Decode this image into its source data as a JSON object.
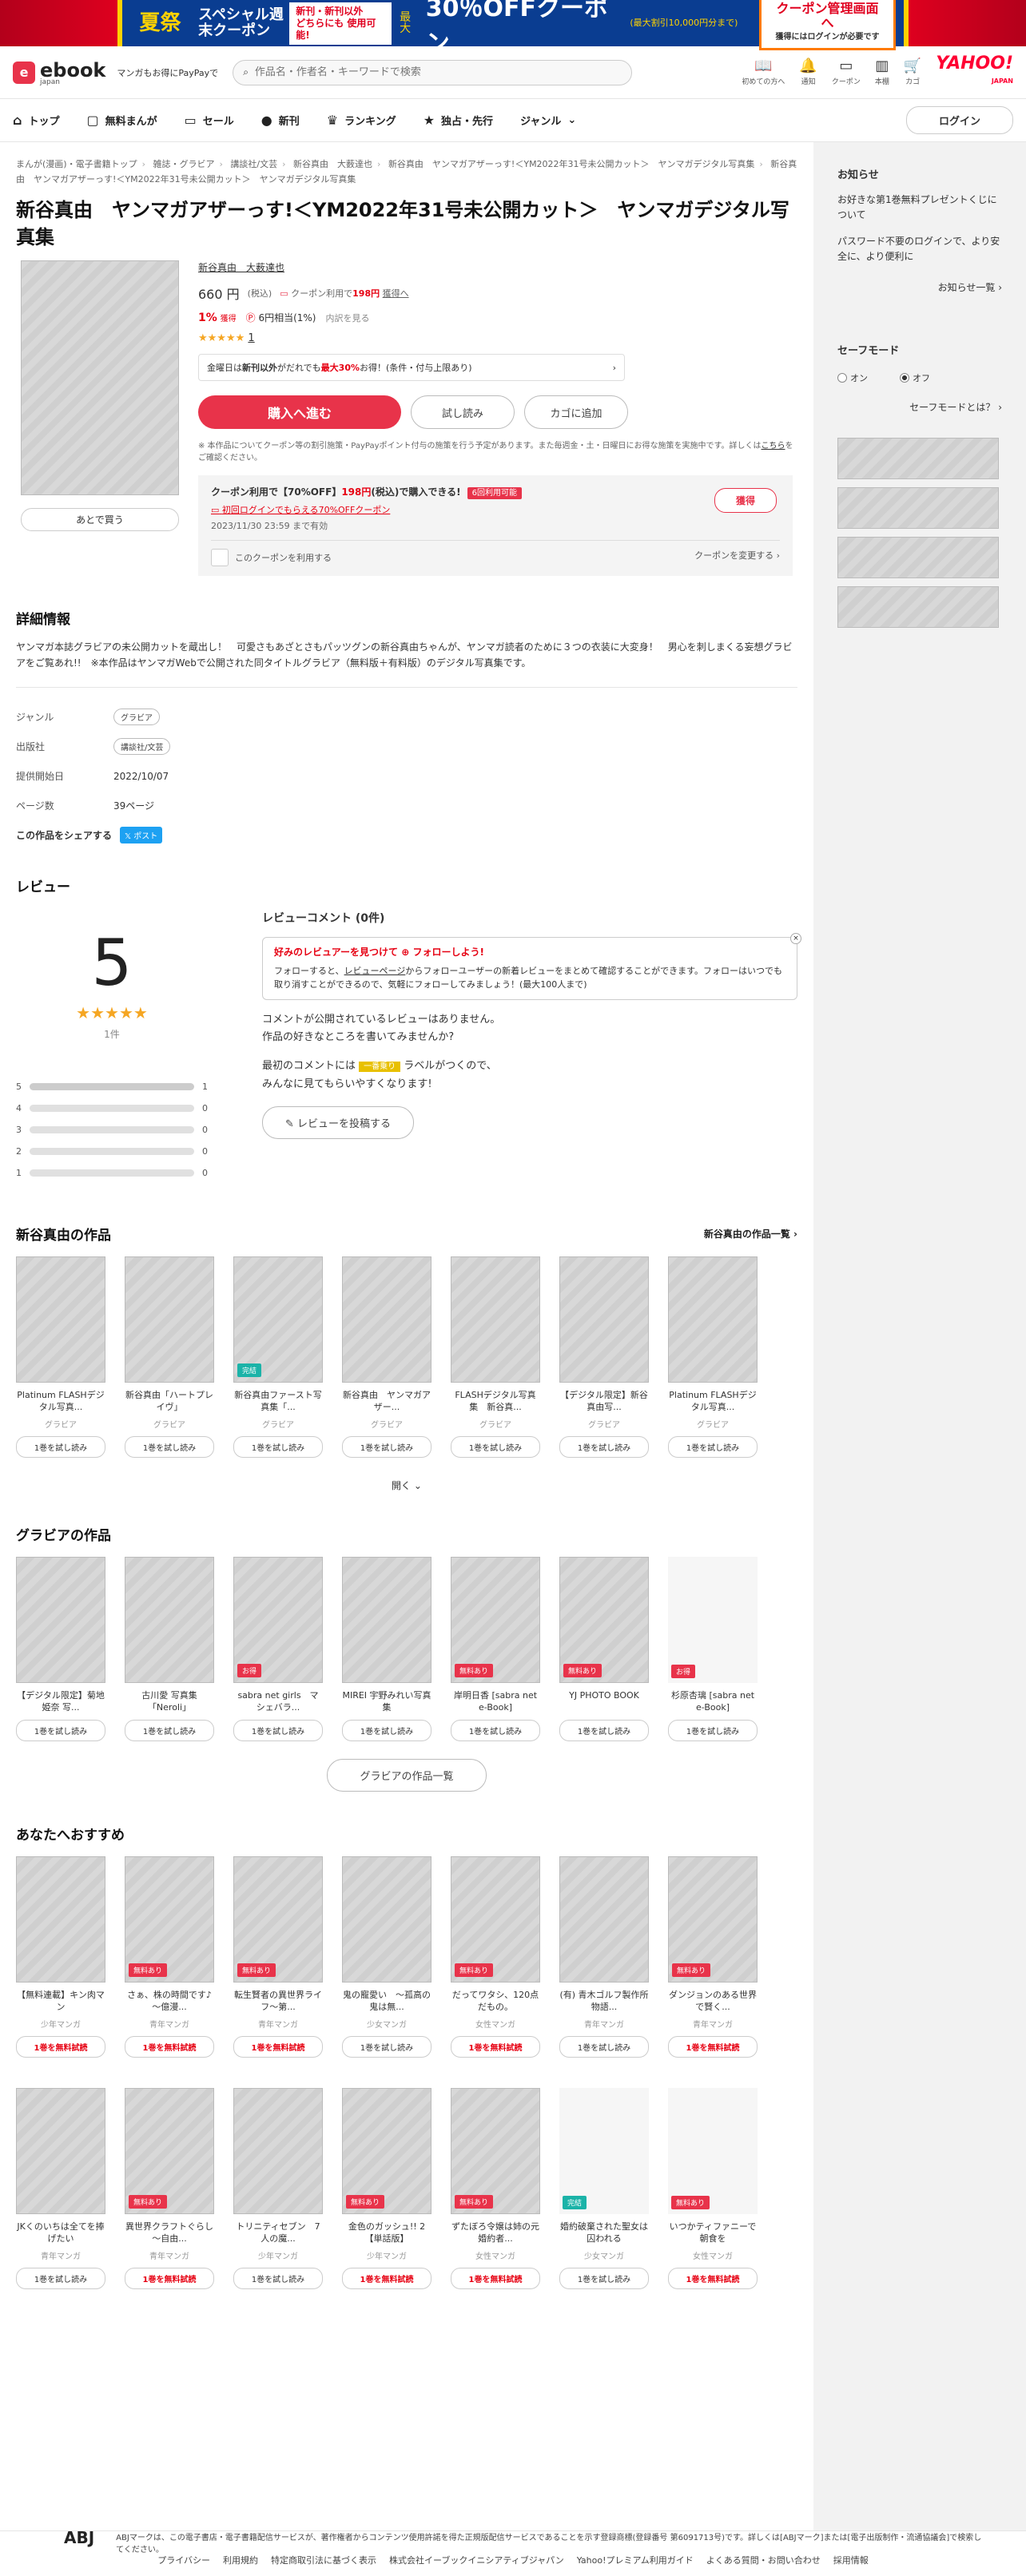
{
  "banner": {
    "a": "夏祭",
    "b": "スペシャル週末クーポン",
    "c1": "新刊・新刊以外",
    "c2": "どちらにも 使用可能!",
    "d_pre": "最大",
    "d": "30％OFFクーポン",
    "e": "(最大割引10,000円分まで)",
    "f": "クーポン管理画面へ",
    "f_sub": "獲得にはログインが必要です"
  },
  "header": {
    "logo": "ebook",
    "logo_sub": "japan",
    "tagline": "マンガもお得にPayPayで",
    "search_placeholder": "作品名・作者名・キーワードで検索",
    "icons": [
      {
        "label": "初めての方へ",
        "icon": "book-icon"
      },
      {
        "label": "通知",
        "icon": "bell-icon"
      },
      {
        "label": "クーポン",
        "icon": "ticket-icon"
      },
      {
        "label": "本棚",
        "icon": "bookshelf-icon"
      },
      {
        "label": "カゴ",
        "icon": "cart-icon"
      }
    ],
    "yahoo": "YAHOO!",
    "yahoo_sub": "JAPAN"
  },
  "nav": {
    "items": [
      "トップ",
      "無料まんが",
      "セール",
      "新刊",
      "ランキング",
      "独占・先行",
      "ジャンル"
    ],
    "login": "ログイン"
  },
  "breadcrumb": [
    "まんが(漫画)・電子書籍トップ",
    "雑誌・グラビア",
    "講談社/文芸",
    "新谷真由　大薮達也",
    "新谷真由　ヤンマガアザーっす!＜YM2022年31号未公開カット＞　ヤンマガデジタル写真集",
    "新谷真由　ヤンマガアザーっす!＜YM2022年31号未公開カット＞　ヤンマガデジタル写真集"
  ],
  "product": {
    "title": "新谷真由　ヤンマガアザーっす!＜YM2022年31号未公開カット＞　ヤンマガデジタル写真集",
    "authors": "新谷真由　大薮達也",
    "later": "あとで買う",
    "price": "660 円",
    "price_tax": "(税込)",
    "coupon_pre": "クーポン利用で",
    "coupon_price": "198円",
    "coupon_post": "獲得へ",
    "pt_pct": "1%",
    "pt_label": "獲得",
    "pt_pay": "6円相当(1%)",
    "pt_more": "内訳を見る",
    "rating_count": "1",
    "pr_pre": "金曜日は",
    "pr_bold": "新刊以外",
    "pr_mid": "がだれでも",
    "pr_red": "最大30%",
    "pr_post": "お得！(条件・付与上限あり)",
    "buy": "購入へ進む",
    "trial": "試し読み",
    "cart": "カゴに追加",
    "note": "※ 本作品についてクーポン等の割引施策・PayPayポイント付与の施策を行う予定があります。また毎週金・土・日曜日にお得な施策を実施中です。詳しくは",
    "note_link": "こちら",
    "note_post": "をご確認ください。"
  },
  "coupon": {
    "line1_pre": "クーポン利用で【70%OFF】",
    "line1_price": "198円",
    "line1_post": "(税込)で購入できる!",
    "tag": "6回利用可能",
    "line2": "初回ログインでもらえる70%OFFクーポン",
    "line3": "2023/11/30 23:59 まで有効",
    "get": "獲得",
    "use": "このクーポンを利用する",
    "change": "クーポンを変更する"
  },
  "details": {
    "heading": "詳細情報",
    "description": "ヤンマガ本誌グラビアの未公開カットを蔵出し！　可愛さもあざとさもパッツグンの新谷真由ちゃんが、ヤンマガ読者のために３つの衣装に大変身！　男心を刺しまくる妄想グラビアをご覧あれ!!　※本作品はヤンマガWebで公開された同タイトルグラビア（無料版＋有料版）のデジタル写真集です。",
    "rows": [
      {
        "k": "ジャンル",
        "v": "グラビア",
        "chip": true
      },
      {
        "k": "出版社",
        "v": "講談社/文芸",
        "chip": true
      },
      {
        "k": "提供開始日",
        "v": "2022/10/07",
        "chip": false
      },
      {
        "k": "ページ数",
        "v": "39ページ",
        "chip": false
      }
    ],
    "share": "この作品をシェアする",
    "tw": "ポスト"
  },
  "review": {
    "heading": "レビュー",
    "score": "5",
    "count": "1件",
    "dist": [
      {
        "s": "5",
        "n": "1",
        "f": 1
      },
      {
        "s": "4",
        "n": "0",
        "f": 0
      },
      {
        "s": "3",
        "n": "0",
        "f": 0
      },
      {
        "s": "2",
        "n": "0",
        "f": 0
      },
      {
        "s": "1",
        "n": "0",
        "f": 0
      }
    ],
    "comments_heading": "レビューコメント (0件)",
    "follow_title": "好みのレビュアーを見つけて ⊕ フォローしよう!",
    "follow_body_pre": "フォローすると、",
    "follow_link": "レビューページ",
    "follow_body_post": "からフォローユーザーの新着レビューをまとめて確認することができます。フォローはいつでも取り消すことができるので、気軽にフォローしてみましょう！(最大100人まで)",
    "none1": "コメントが公開されているレビューはありません。",
    "none2": "作品の好きなところを書いてみませんか?",
    "first_pre": "最初のコメントには",
    "first_label": "一番乗り",
    "first_post": "ラベルがつくので、",
    "first2": "みんなに見てもらいやすくなります!",
    "post": "レビューを投稿する"
  },
  "works": {
    "heading": "新谷真由の作品",
    "all": "新谷真由の作品一覧",
    "items": [
      {
        "t": "Platinum FLASHデジタル写真...",
        "g": "グラビア",
        "b": "",
        "btn": "1巻を試し読み"
      },
      {
        "t": "新谷真由「ハートプレイヴ」",
        "g": "グラビア",
        "b": "",
        "btn": "1巻を試し読み"
      },
      {
        "t": "新谷真由ファースト写真集「...",
        "g": "グラビア",
        "b": "完結",
        "btn": "1巻を試し読み"
      },
      {
        "t": "新谷真由　ヤンマガアザー...",
        "g": "グラビア",
        "b": "",
        "btn": "1巻を試し読み"
      },
      {
        "t": "FLASHデジタル写真集　新谷真...",
        "g": "グラビア",
        "b": "",
        "btn": "1巻を試し読み"
      },
      {
        "t": "【デジタル限定】新谷真由写...",
        "g": "グラビア",
        "b": "",
        "btn": "1巻を試し読み"
      },
      {
        "t": "Platinum FLASHデジタル写真...",
        "g": "グラビア",
        "b": "",
        "btn": "1巻を試し読み"
      }
    ],
    "more": "開く"
  },
  "gravure": {
    "heading": "グラビアの作品",
    "items": [
      {
        "t": "【デジタル限定】菊地姫奈 写...",
        "b": "",
        "btn": "1巻を試し読み"
      },
      {
        "t": "古川愛 写真集「Neroli」",
        "b": "",
        "btn": "1巻を試し読み"
      },
      {
        "t": "sabra net girls　マシェバラ...",
        "b": "お得",
        "btn": "1巻を試し読み"
      },
      {
        "t": "MIREI 宇野みれい写真集",
        "b": "",
        "btn": "1巻を試し読み"
      },
      {
        "t": "岸明日香 [sabra net e-Book]",
        "b": "無料あり",
        "btn": "1巻を試し読み"
      },
      {
        "t": "YJ PHOTO BOOK",
        "b": "無料あり",
        "btn": "1巻を試し読み"
      },
      {
        "t": "杉原杏璃 [sabra net e-Book]",
        "b": "お得",
        "btn": "1巻を試し読み"
      }
    ],
    "list": "グラビアの作品一覧"
  },
  "reco": {
    "heading": "あなたへおすすめ",
    "row1": [
      {
        "t": "【無料連載】キン肉マン",
        "g": "少年マンガ",
        "b": "",
        "btn": "1巻を無料試読"
      },
      {
        "t": "さぁ、株の時間です♪ ～億漫...",
        "g": "青年マンガ",
        "b": "無料あり",
        "btn": "1巻を無料試読"
      },
      {
        "t": "転生賢者の異世界ライフ～第...",
        "g": "青年マンガ",
        "b": "無料あり",
        "btn": "1巻を無料試読"
      },
      {
        "t": "鬼の寵愛い　～孤高の鬼は無...",
        "g": "少女マンガ",
        "b": "",
        "btn": "1巻を試し読み"
      },
      {
        "t": "だってワタシ、120点だもの。",
        "g": "女性マンガ",
        "b": "無料あり",
        "btn": "1巻を無料試読"
      },
      {
        "t": "(有) 青木ゴルフ製作所物語...",
        "g": "青年マンガ",
        "b": "",
        "btn": "1巻を試し読み"
      },
      {
        "t": "ダンジョンのある世界で賢く...",
        "g": "青年マンガ",
        "b": "無料あり",
        "btn": "1巻を無料試読"
      }
    ],
    "row2": [
      {
        "t": "JKくのいちは全てを捧げたい",
        "g": "青年マンガ",
        "b": "",
        "btn": "1巻を試し読み"
      },
      {
        "t": "異世界クラフトぐらし～自由...",
        "g": "青年マンガ",
        "b": "無料あり",
        "btn": "1巻を無料試読"
      },
      {
        "t": "トリニティセブン　7人の魔...",
        "g": "少年マンガ",
        "b": "",
        "btn": "1巻を試し読み"
      },
      {
        "t": "金色のガッシュ!! 2【単話版】",
        "g": "少年マンガ",
        "b": "無料あり",
        "btn": "1巻を無料試読"
      },
      {
        "t": "ずたぼろ令嬢は姉の元婚約者...",
        "g": "女性マンガ",
        "b": "無料あり",
        "btn": "1巻を無料試読"
      },
      {
        "t": "婚約破棄された聖女は囚われる",
        "g": "少女マンガ",
        "b": "完結",
        "btn": "1巻を試し読み"
      },
      {
        "t": "いつかティファニーで朝食を",
        "g": "女性マンガ",
        "b": "無料あり",
        "btn": "1巻を無料試読"
      }
    ]
  },
  "side": {
    "news": "お知らせ",
    "p1": "お好きな第1巻無料プレゼントくじについて",
    "p2": "パスワード不要のログインで、より安全に、より便利に",
    "newslink": "お知らせ一覧",
    "safe": "セーフモード",
    "on": "オン",
    "off": "オフ",
    "safelink": "セーフモードとは？"
  },
  "footer": {
    "links": [
      "プライバシー",
      "利用規約",
      "特定商取引法に基づく表示",
      "株式会社イーブックイニシアティブジャパン",
      "Yahoo!プレミアム利用ガイド",
      "よくある質問・お問い合わせ",
      "採用情報"
    ],
    "abj_mark": "ABJ",
    "abj_text": "ABJマークは、この電子書店・電子書籍配信サービスが、著作権者からコンテンツ使用許諾を得た正規版配信サービスであることを示す登録商標(登録番号 第6091713号)です。詳しくは[ABJマーク]または[電子出版制作・流通協議会]で検索してください。"
  }
}
